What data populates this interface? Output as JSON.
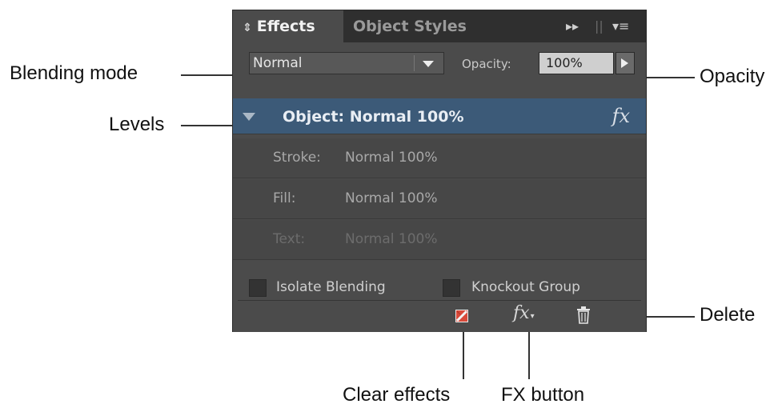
{
  "panel": {
    "tabs": {
      "effects": "Effects",
      "object_styles": "Object Styles"
    },
    "tab_effects_glyph": "⇕",
    "menu_glyphs": {
      "forward": "▸▸",
      "divider": "||",
      "menu": "▾≡"
    },
    "blend_mode": "Normal",
    "opacity_label": "Opacity:",
    "opacity_value": "100%",
    "levels": [
      {
        "label": "Object: Normal 100%",
        "fx": "fx"
      },
      {
        "name": "Stroke:",
        "value": "Normal 100%"
      },
      {
        "name": "Fill:",
        "value": "Normal 100%"
      },
      {
        "name": "Text:",
        "value": "Normal 100%"
      }
    ],
    "checkboxes": [
      {
        "label": "Isolate Blending",
        "checked": false
      },
      {
        "label": "Knockout Group",
        "checked": false
      }
    ],
    "footer": {
      "fx_label": "fx",
      "fx_caret": "▾"
    },
    "colors": {
      "panel_bg": "#4b4b4b",
      "selected_level": "#3c5a78",
      "tabbar": "#2f2f2f"
    }
  },
  "callouts": {
    "blending_mode": "Blending mode",
    "levels": "Levels",
    "opacity": "Opacity",
    "delete": "Delete",
    "clear_effects": "Clear effects",
    "fx_button": "FX button"
  }
}
